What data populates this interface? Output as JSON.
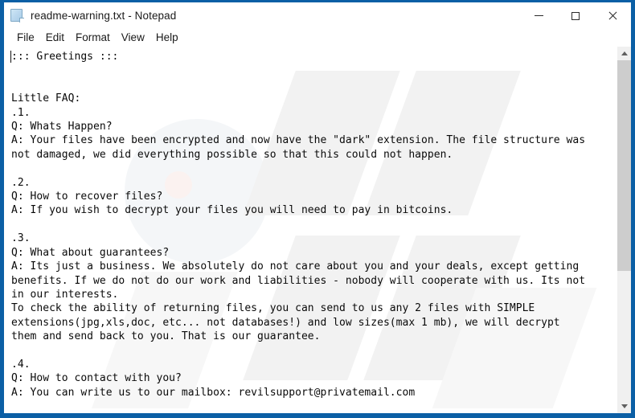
{
  "window": {
    "title": "readme-warning.txt - Notepad",
    "icon": "notepad-document-icon",
    "border_color": "#0b5fa5",
    "controls": {
      "minimize_label": "Minimize",
      "maximize_label": "Maximize",
      "close_label": "Close"
    }
  },
  "menubar": {
    "items": [
      {
        "label": "File"
      },
      {
        "label": "Edit"
      },
      {
        "label": "Format"
      },
      {
        "label": "View"
      },
      {
        "label": "Help"
      }
    ]
  },
  "editor": {
    "content": "::: Greetings :::\n\n\nLittle FAQ:\n.1.\nQ: Whats Happen?\nA: Your files have been encrypted and now have the \"dark\" extension. The file structure was\nnot damaged, we did everything possible so that this could not happen.\n\n.2.\nQ: How to recover files?\nA: If you wish to decrypt your files you will need to pay in bitcoins.\n\n.3.\nQ: What about guarantees?\nA: Its just a business. We absolutely do not care about you and your deals, except getting\nbenefits. If we do not do our work and liabilities - nobody will cooperate with us. Its not\nin our interests.\nTo check the ability of returning files, you can send to us any 2 files with SIMPLE\nextensions(jpg,xls,doc, etc... not databases!) and low sizes(max 1 mb), we will decrypt\nthem and send back to you. That is our guarantee.\n\n.4.\nQ: How to contact with you?\nA: You can write us to our mailbox: revilsupport@privatemail.com",
    "contact_email": "revilsupport@privatemail.com",
    "file_extension": "dark",
    "text_color": "#0a0a0a",
    "background_color": "#ffffff"
  },
  "scrollbar": {
    "up_arrow": "scroll-up-arrow",
    "down_arrow": "scroll-down-arrow",
    "thumb_top_percent": 0,
    "thumb_height_percent": 62
  }
}
